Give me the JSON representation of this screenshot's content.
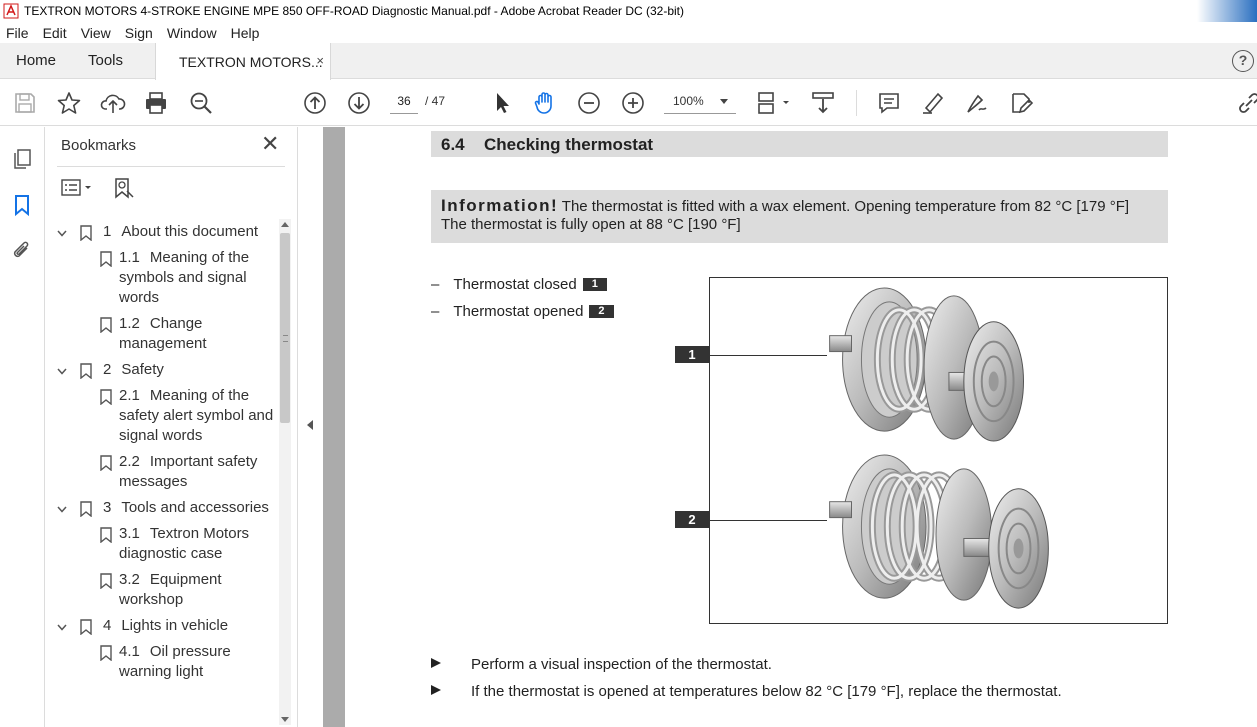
{
  "window": {
    "title": "TEXTRON MOTORS 4-STROKE ENGINE MPE 850 OFF-ROAD Diagnostic Manual.pdf - Adobe Acrobat Reader DC (32-bit)"
  },
  "menu": [
    "File",
    "Edit",
    "View",
    "Sign",
    "Window",
    "Help"
  ],
  "tabs": {
    "home": "Home",
    "tools": "Tools",
    "document": "TEXTRON MOTORS...",
    "close": "×",
    "help": "?"
  },
  "toolbar": {
    "current_page": "36",
    "total_pages": "/ 47",
    "zoom": "100%",
    "icons": [
      "save-icon",
      "star-icon",
      "upload-icon",
      "print-icon",
      "search-zoom-icon",
      "page-up-icon",
      "page-down-icon",
      "select-icon",
      "hand-icon",
      "zoom-out-icon",
      "zoom-in-icon",
      "page-layout-icon",
      "scroll-mode-icon",
      "comment-icon",
      "highlight-icon",
      "sign-icon",
      "edit-pdf-icon",
      "share-link-icon"
    ]
  },
  "bookmarks": {
    "title": "Bookmarks",
    "close": "✕",
    "items": [
      {
        "level": 1,
        "num": "1",
        "lines": [
          "About this document"
        ]
      },
      {
        "level": 2,
        "num": "1.1",
        "lines": [
          "Meaning of the",
          "symbols and signal",
          "words"
        ]
      },
      {
        "level": 2,
        "num": "1.2",
        "lines": [
          "Change",
          "management"
        ]
      },
      {
        "level": 1,
        "num": "2",
        "lines": [
          "Safety"
        ]
      },
      {
        "level": 2,
        "num": "2.1",
        "lines": [
          "Meaning of the",
          "safety alert symbol and",
          "signal words"
        ]
      },
      {
        "level": 2,
        "num": "2.2",
        "lines": [
          "Important safety",
          "messages"
        ]
      },
      {
        "level": 1,
        "num": "3",
        "lines": [
          "Tools and accessories"
        ]
      },
      {
        "level": 2,
        "num": "3.1",
        "lines": [
          "Textron Motors",
          "diagnostic case"
        ]
      },
      {
        "level": 2,
        "num": "3.2",
        "lines": [
          "Equipment",
          "workshop"
        ]
      },
      {
        "level": 1,
        "num": "4",
        "lines": [
          "Lights in vehicle"
        ]
      },
      {
        "level": 2,
        "num": "4.1",
        "lines": [
          "Oil pressure",
          "warning light"
        ]
      }
    ]
  },
  "document": {
    "section_number": "6.4",
    "section_title": "Checking thermostat",
    "info_label": "Information!",
    "info_line1": "The thermostat is fitted with a wax element. Opening temperature from 82 °C [179 °F]",
    "info_line2": "The thermostat is fully open at 88 °C [190 °F]",
    "legend": [
      {
        "dash": "–",
        "text": "Thermostat closed",
        "badge": "1"
      },
      {
        "dash": "–",
        "text": "Thermostat opened",
        "badge": "2"
      }
    ],
    "callouts": [
      "1",
      "2"
    ],
    "actions": [
      "Perform a visual inspection of the thermostat.",
      "If the thermostat is opened at temperatures below 82 °C [179 °F], replace the thermostat."
    ]
  }
}
